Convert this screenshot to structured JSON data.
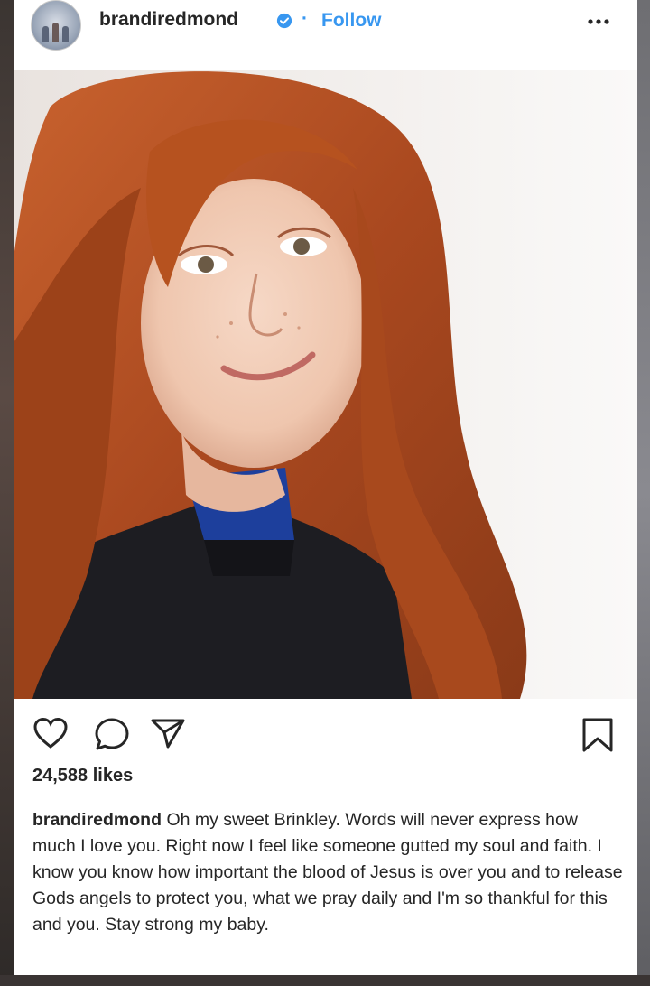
{
  "header": {
    "username": "brandiredmond",
    "separator": "·",
    "follow_label": "Follow"
  },
  "post": {
    "likes": "24,588 likes",
    "caption_user": "brandiredmond",
    "caption_text": "Oh my sweet Brinkley. Words will never express how much I love you. Right now I feel like someone gutted my soul and faith. I know you know how important the blood of Jesus is over you and to release Gods angels to protect you, what we pray daily and I'm so thankful for this and you. Stay strong my baby."
  },
  "icons": {
    "verified": "verified-badge-icon",
    "more": "more-options-icon",
    "like": "heart-icon",
    "comment": "comment-icon",
    "share": "share-icon",
    "save": "bookmark-icon"
  },
  "colors": {
    "accent": "#3897f0",
    "text": "#262626",
    "hair": "#b5542a"
  }
}
